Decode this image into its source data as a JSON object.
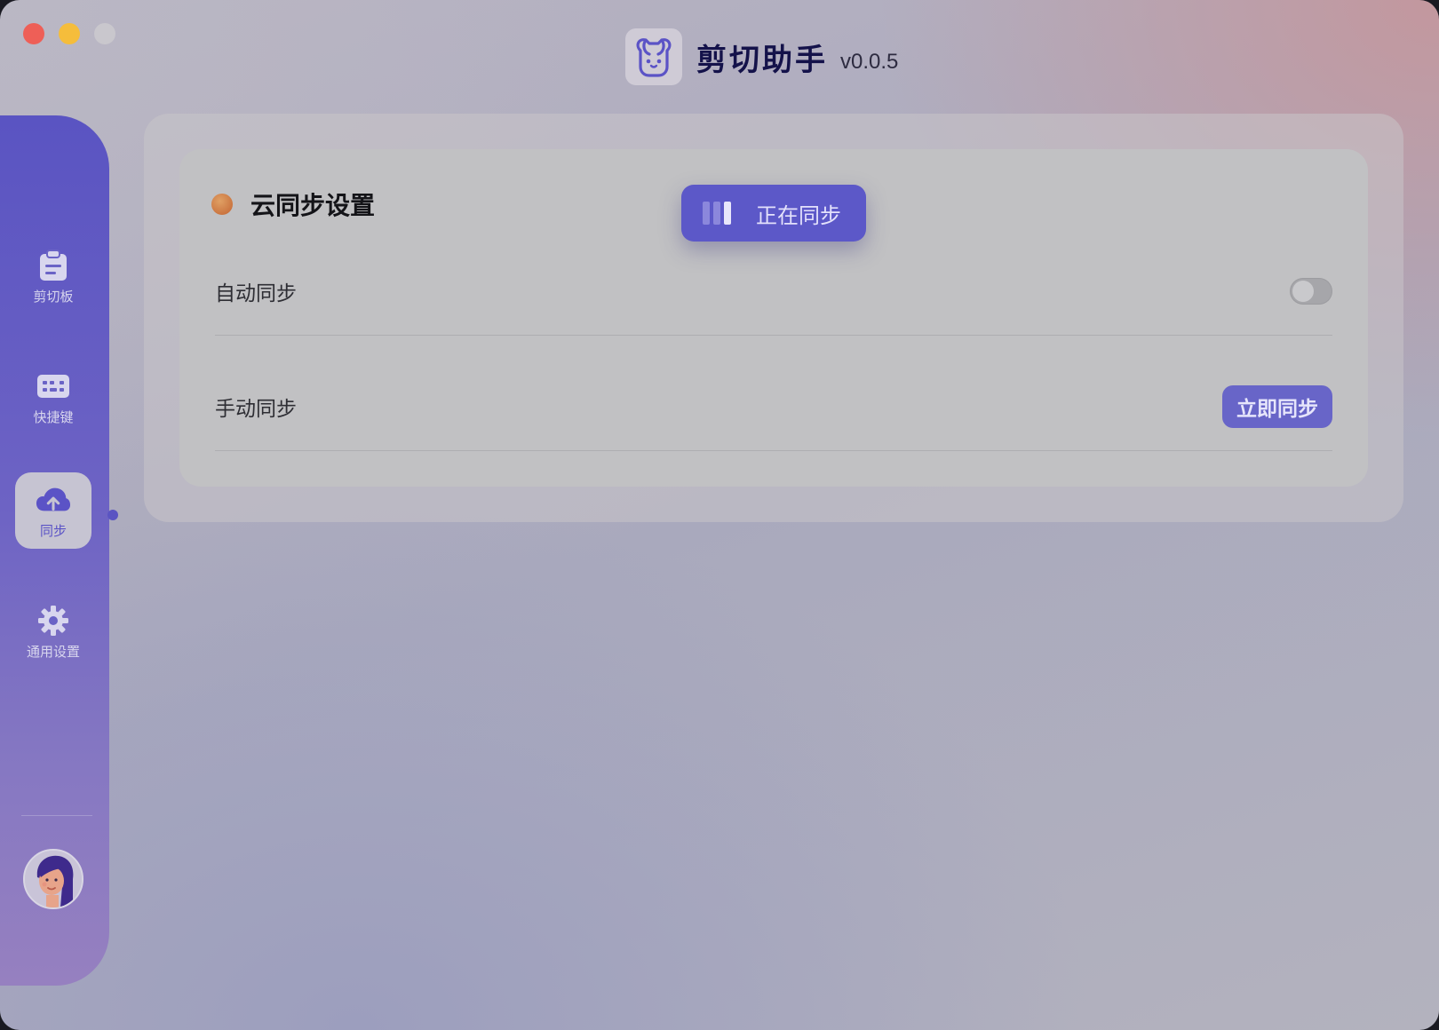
{
  "window": {
    "traffic_lights": [
      "close",
      "minimize",
      "maximize"
    ]
  },
  "header": {
    "title": "剪切助手",
    "version": "v0.0.5",
    "logo_icon": "dog-face-icon"
  },
  "sidebar": {
    "items": [
      {
        "id": "clipboard",
        "label": "剪切板",
        "icon": "clipboard-icon",
        "active": false
      },
      {
        "id": "shortcuts",
        "label": "快捷键",
        "icon": "keyboard-icon",
        "active": false
      },
      {
        "id": "sync",
        "label": "同步",
        "icon": "cloud-upload-icon",
        "active": true
      },
      {
        "id": "general",
        "label": "通用设置",
        "icon": "gear-icon",
        "active": false
      }
    ],
    "avatar": "user-avatar"
  },
  "sync_card": {
    "title": "云同步设置",
    "status_button_label": "正在同步",
    "rows": [
      {
        "label": "自动同步",
        "control": "toggle",
        "value": false
      },
      {
        "label": "手动同步",
        "control": "button",
        "button_label": "立即同步"
      }
    ]
  },
  "colors": {
    "accent": "#5c58c8",
    "sidebar_top": "#5a54c2",
    "status_dot": "#c8703c"
  }
}
